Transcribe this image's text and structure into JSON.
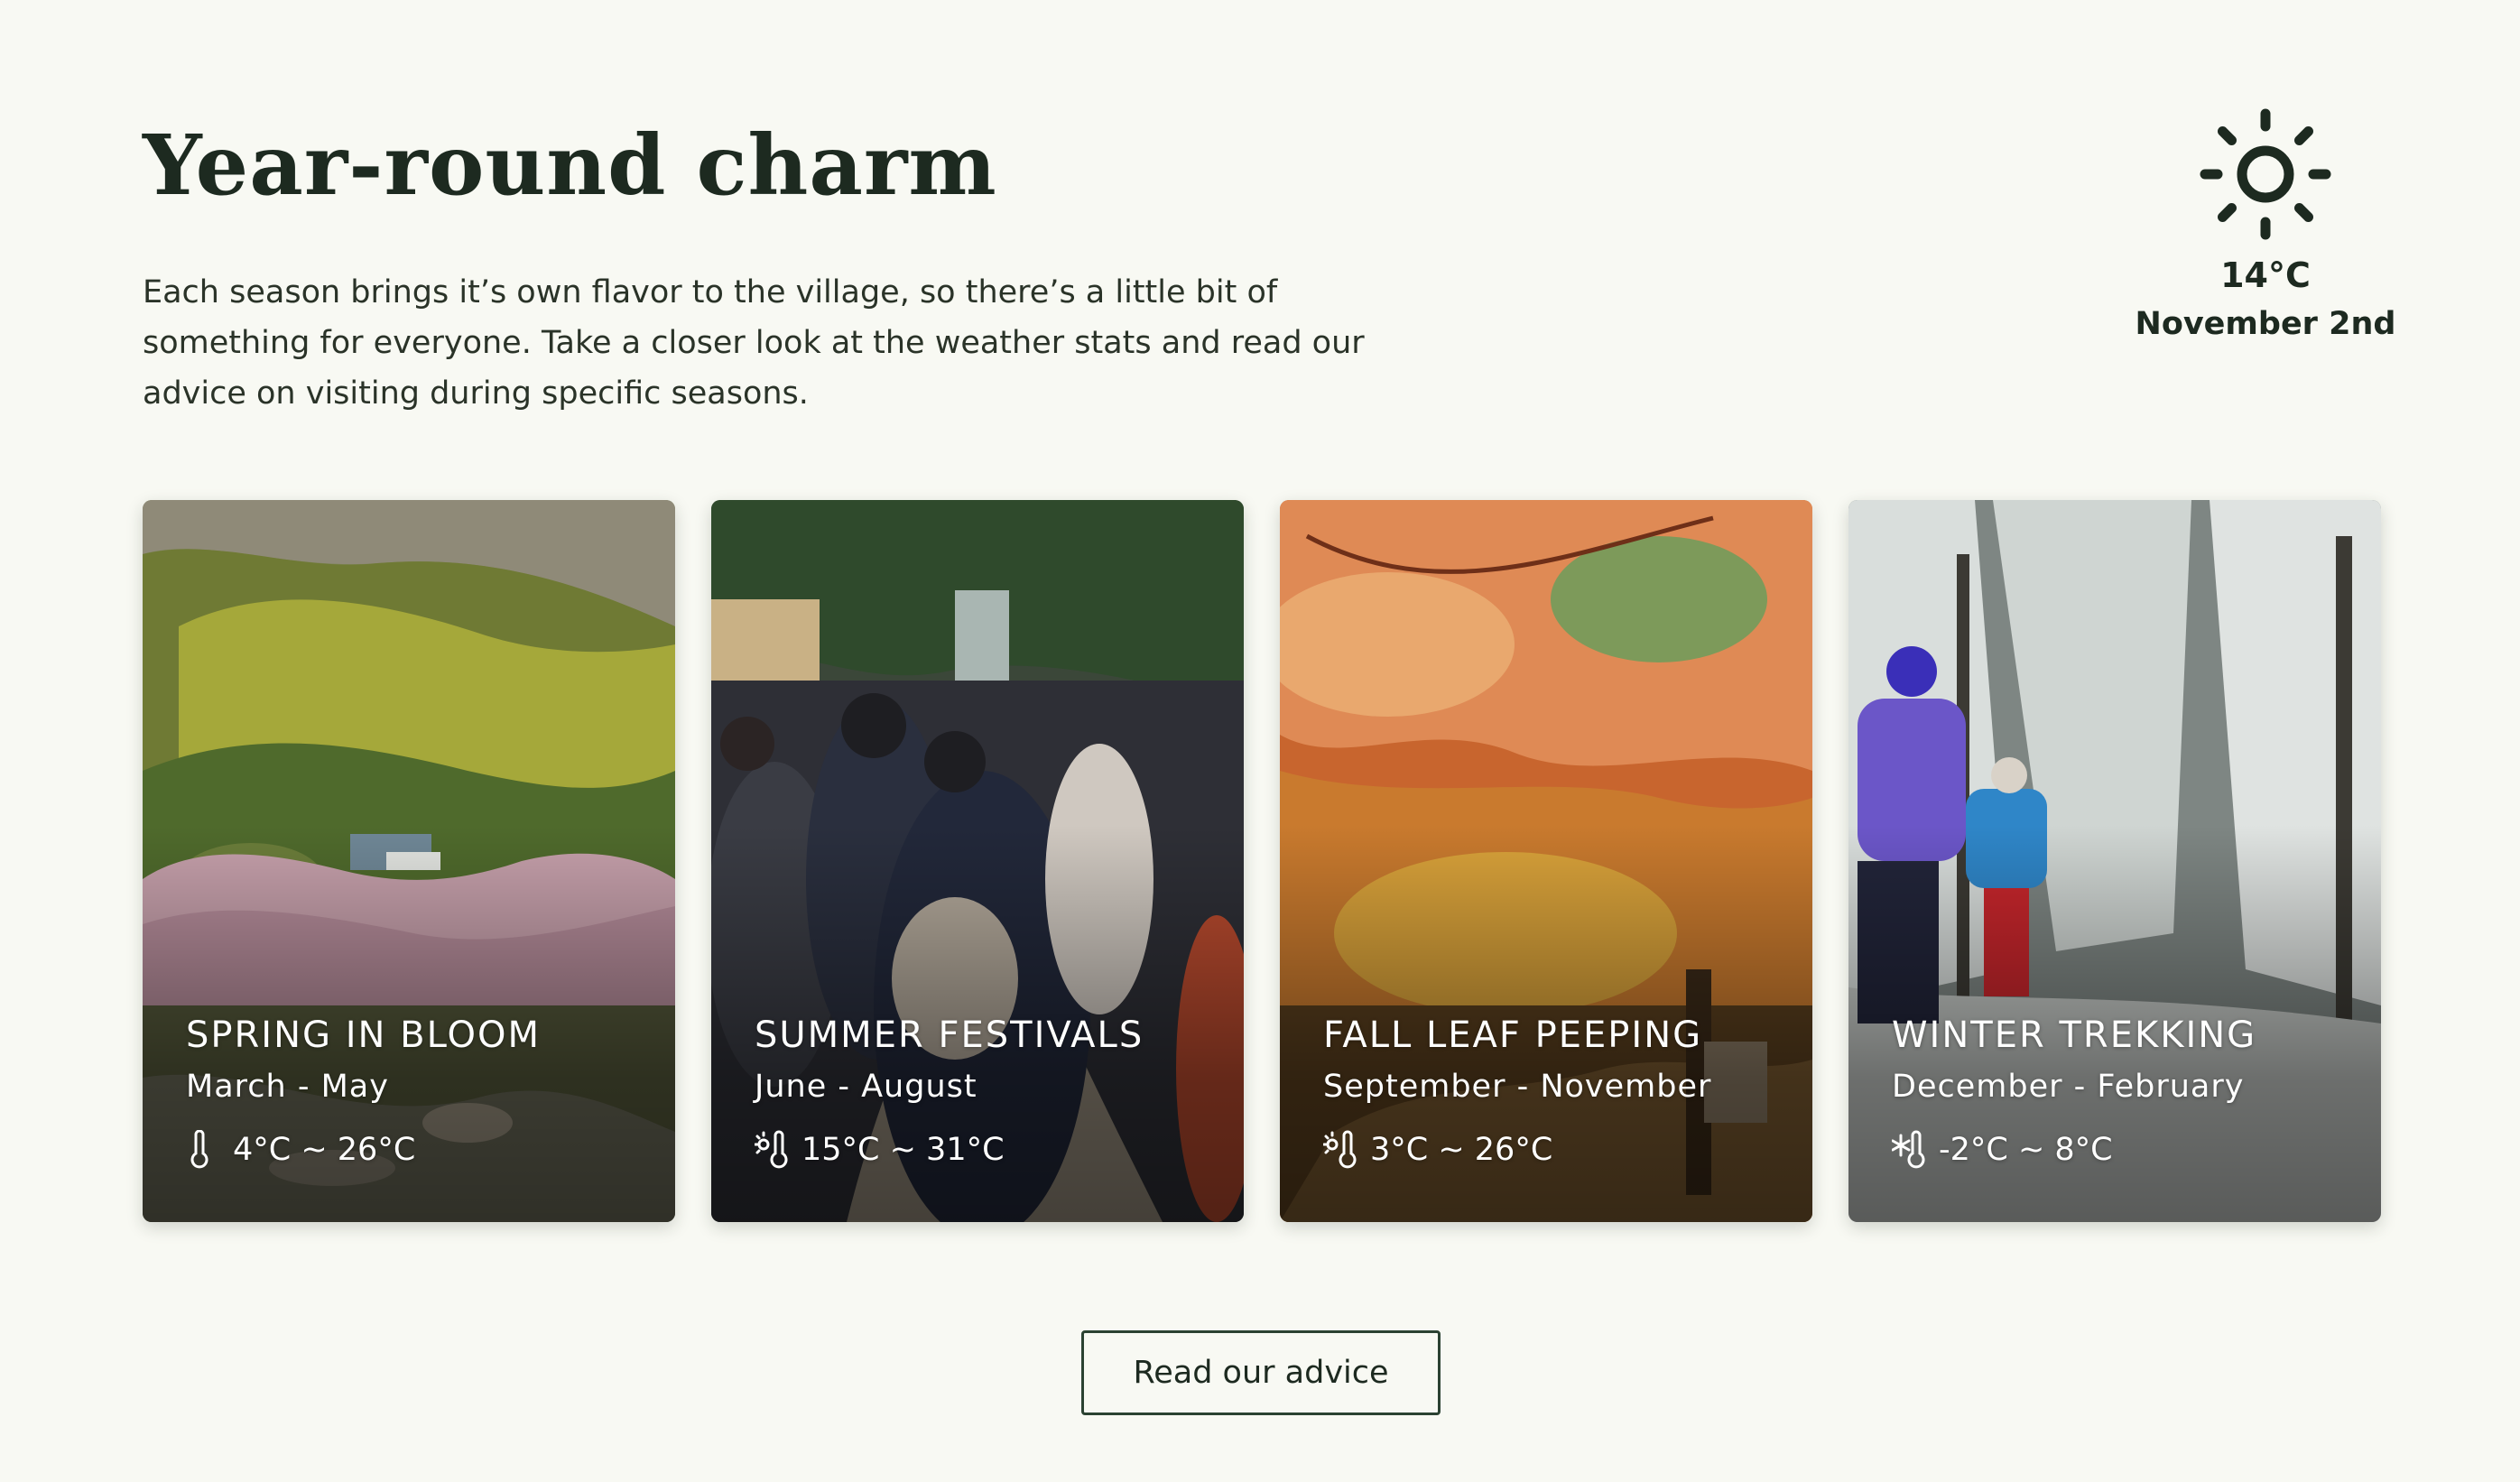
{
  "section": {
    "title": "Year-round charm",
    "intro": "Each season brings it’s own flavor to the village, so there’s a little bit of something for everyone. Take a closer look at the weather stats and read our advice on visiting during specific seasons."
  },
  "weather": {
    "icon": "sun-icon",
    "temperature": "14°C",
    "date": "November 2nd"
  },
  "cards": [
    {
      "title": "SPRING IN BLOOM",
      "months": "March - May",
      "temperature": "4°C ~ 26°C",
      "icon": "thermometer-icon"
    },
    {
      "title": "SUMMER FESTIVALS",
      "months": "June - August",
      "temperature": "15°C ~ 31°C",
      "icon": "thermometer-sun-icon"
    },
    {
      "title": "FALL LEAF PEEPING",
      "months": "September - November",
      "temperature": "3°C ~ 26°C",
      "icon": "thermometer-sun-icon"
    },
    {
      "title": "WINTER TREKKING",
      "months": "December - February",
      "temperature": "-2°C ~ 8°C",
      "icon": "thermometer-snowflake-icon"
    }
  ],
  "cta": {
    "label": "Read our advice"
  },
  "colors": {
    "background": "#f8f9f3",
    "text": "#1d2a20",
    "button_border": "#2b4232"
  }
}
